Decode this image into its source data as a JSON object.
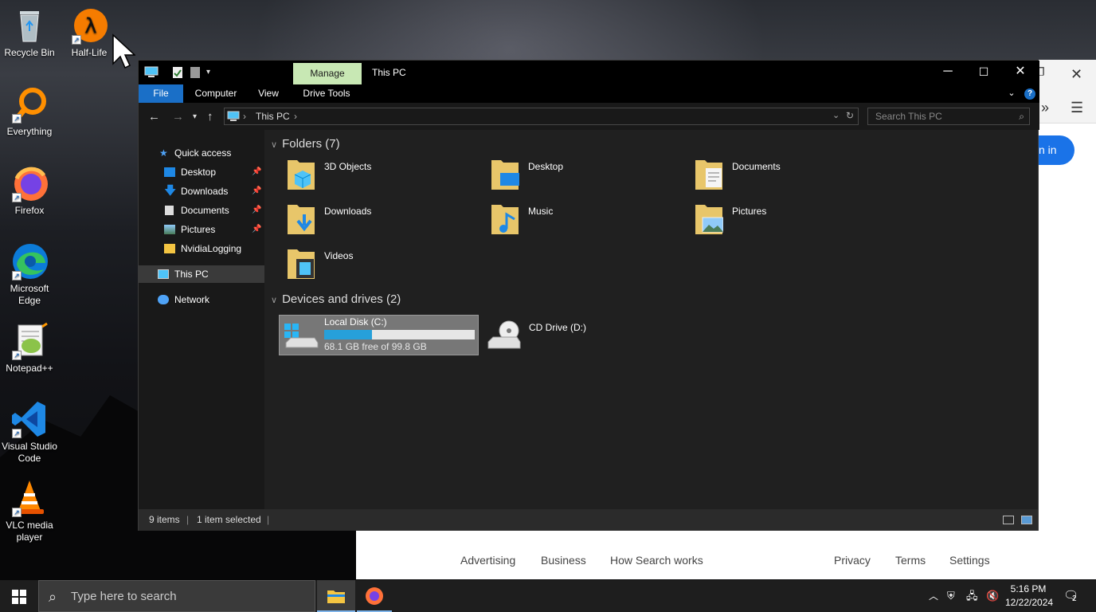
{
  "desktop": {
    "icons": [
      {
        "label": "Recycle Bin",
        "icon": "recycle-bin-icon"
      },
      {
        "label": "Half-Life",
        "icon": "half-life-icon"
      },
      {
        "label": "Everything",
        "icon": "everything-icon"
      },
      {
        "label": "Firefox",
        "icon": "firefox-icon"
      },
      {
        "label": "Microsoft Edge",
        "icon": "edge-icon"
      },
      {
        "label": "Notepad++",
        "icon": "notepadpp-icon"
      },
      {
        "label": "Visual Studio Code",
        "icon": "vscode-icon"
      },
      {
        "label": "VLC media player",
        "icon": "vlc-icon"
      }
    ]
  },
  "browser": {
    "signin": "n in",
    "footer": [
      "Advertising",
      "Business",
      "How Search works",
      "Privacy",
      "Terms",
      "Settings"
    ]
  },
  "explorer": {
    "manage_tab": "Manage",
    "title": "This PC",
    "ribbon_tabs": [
      "File",
      "Computer",
      "View",
      "Drive Tools"
    ],
    "address": "This PC",
    "search_placeholder": "Search This PC",
    "sidebar": [
      {
        "label": "Quick access",
        "icon": "star-icon"
      },
      {
        "label": "Desktop",
        "icon": "desktop-icon"
      },
      {
        "label": "Downloads",
        "icon": "download-icon"
      },
      {
        "label": "Documents",
        "icon": "documents-icon"
      },
      {
        "label": "Pictures",
        "icon": "pictures-icon"
      },
      {
        "label": "NvidiaLogging",
        "icon": "folder-icon"
      },
      {
        "label": "This PC",
        "icon": "computer-icon"
      },
      {
        "label": "Network",
        "icon": "network-icon"
      }
    ],
    "folders_heading": "Folders (7)",
    "folders": [
      "3D Objects",
      "Desktop",
      "Documents",
      "Downloads",
      "Music",
      "Pictures",
      "Videos"
    ],
    "drives_heading": "Devices and drives (2)",
    "drives": [
      {
        "name": "Local Disk (C:)",
        "free": "68.1 GB free of 99.8 GB",
        "used_fraction": 0.318
      },
      {
        "name": "CD Drive (D:)"
      }
    ],
    "status": {
      "items": "9 items",
      "selected": "1 item selected"
    }
  },
  "taskbar": {
    "search_placeholder": "Type here to search",
    "time": "5:16 PM",
    "date": "12/22/2024",
    "notifications": "2"
  }
}
